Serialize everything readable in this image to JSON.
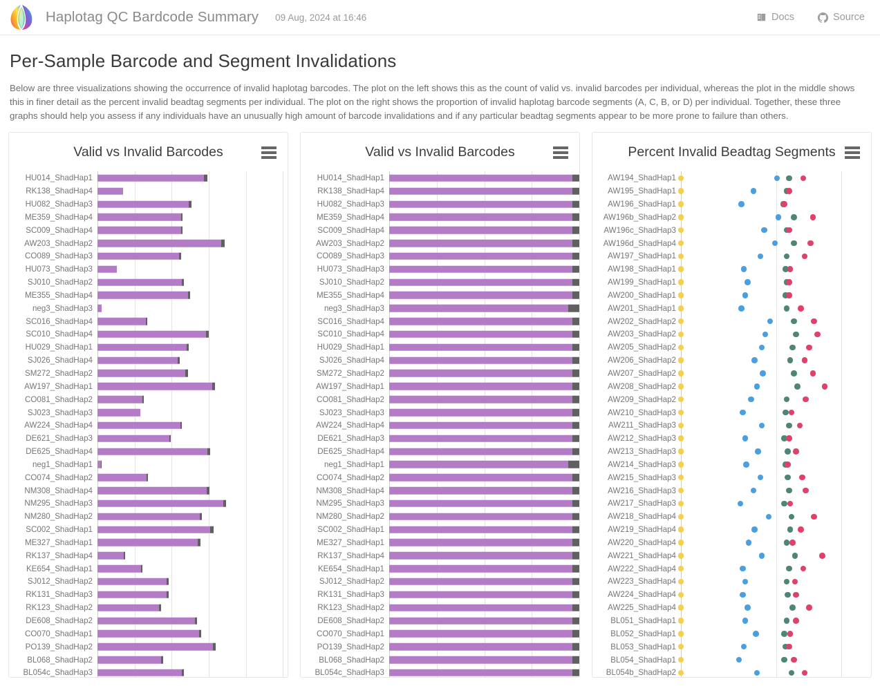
{
  "header": {
    "title": "Haplotag QC Bardcode Summary",
    "date": "09 Aug, 2024 at 16:46",
    "logo_icon": "harpy-feather-logo-icon",
    "links": [
      {
        "label": "Docs",
        "icon": "book-icon"
      },
      {
        "label": "Source",
        "icon": "github-icon"
      }
    ]
  },
  "section": {
    "title": "Per-Sample Barcode and Segment Invalidations",
    "description": "Below are three visualizations showing the occurrence of invalid haplotag barcodes. The plot on the left shows this as the count of valid vs. invalid barcodes per individual, whereas the plot in the middle shows this in finer detail as the percent invalid beadtag segments per individual. The plot on the right shows the proportion of invalid haplotag barcode segments (A, C, B, or D) per individual. Together, these three graphs should help you assess if any individuals have an unusually high amount of barcode invalidations and if any particular beadtag segments appear to be more prone to failure than others."
  },
  "panels": [
    {
      "title": "Valid vs Invalid Barcodes",
      "menu_icon": "hamburger-menu-icon"
    },
    {
      "title": "Valid vs Invalid Barcodes",
      "menu_icon": "hamburger-menu-icon"
    },
    {
      "title": "Percent Invalid Beadtag Segments",
      "menu_icon": "hamburger-menu-icon"
    }
  ],
  "colors": {
    "valid_bar": "#b47cc7",
    "invalid_bar": "#606060",
    "segment_a": "#f5d04e",
    "segment_c": "#4a9fe0",
    "segment_b": "#4e8574",
    "segment_d": "#e0416b",
    "gridline": "#e3e3e3",
    "axis": "#cdcdcd"
  },
  "chart_data": [
    {
      "type": "bar",
      "title": "Valid vs Invalid Barcodes",
      "orientation": "horizontal",
      "stacked": true,
      "xlabel": "",
      "ylabel": "",
      "grid": true,
      "xlim": [
        0,
        100
      ],
      "legend": [
        "valid",
        "invalid"
      ],
      "categories": [
        "HU014_ShadHap1",
        "RK138_ShadHap4",
        "HU082_ShadHap3",
        "ME359_ShadHap4",
        "SC009_ShadHap4",
        "AW203_ShadHap2",
        "CO089_ShadHap3",
        "HU073_ShadHap3",
        "SJ010_ShadHap2",
        "ME355_ShadHap4",
        "neg3_ShadHap3",
        "SC016_ShadHap4",
        "SC010_ShadHap4",
        "HU029_ShadHap1",
        "SJ026_ShadHap4",
        "SM272_ShadHap2",
        "AW197_ShadHap1",
        "CO081_ShadHap2",
        "SJ023_ShadHap3",
        "AW224_ShadHap4",
        "DE621_ShadHap3",
        "DE625_ShadHap4",
        "neg1_ShadHap1",
        "CO074_ShadHap2",
        "NM308_ShadHap4",
        "NM295_ShadHap3",
        "NM280_ShadHap2",
        "SC002_ShadHap1",
        "ME327_ShadHap1",
        "RK137_ShadHap4",
        "KE654_ShadHap1",
        "SJ012_ShadHap2",
        "RK131_ShadHap3",
        "RK123_ShadHap2",
        "DE608_ShadHap2",
        "CO070_ShadHap1",
        "PO139_ShadHap2",
        "BL068_ShadHap2",
        "BL054c_ShadHap3"
      ],
      "series": [
        {
          "name": "valid",
          "color": "#b47cc7",
          "values": [
            68.5,
            16.5,
            58.5,
            53.5,
            53.5,
            79.5,
            52.5,
            12.5,
            54.0,
            58.0,
            2.5,
            31.0,
            69.5,
            57.0,
            51.5,
            56.5,
            73.5,
            29.0,
            27.5,
            53.0,
            46.0,
            70.5,
            2.0,
            31.5,
            70.0,
            80.5,
            65.5,
            72.5,
            64.5,
            17.0,
            28.0,
            44.5,
            44.5,
            39.5,
            62.5,
            65.0,
            74.0,
            41.0,
            54.0
          ]
        },
        {
          "name": "invalid",
          "color": "#606060",
          "values": [
            1.8,
            0.0,
            1.6,
            1.2,
            1.2,
            2.2,
            1.1,
            0.0,
            1.3,
            1.6,
            0.0,
            1.0,
            1.7,
            1.4,
            1.3,
            1.4,
            2.0,
            0.9,
            0.0,
            1.3,
            1.1,
            1.7,
            0.5,
            1.0,
            1.7,
            2.2,
            1.6,
            1.9,
            1.6,
            0.8,
            0.9,
            1.2,
            1.2,
            1.1,
            1.5,
            1.6,
            2.0,
            1.1,
            1.3
          ]
        }
      ]
    },
    {
      "type": "bar",
      "title": "Valid vs Invalid Barcodes",
      "orientation": "horizontal",
      "stacked": true,
      "normalized": true,
      "xlabel": "",
      "ylabel": "",
      "grid": true,
      "xlim": [
        0,
        100
      ],
      "legend": [
        "valid",
        "invalid"
      ],
      "categories": [
        "HU014_ShadHap1",
        "RK138_ShadHap4",
        "HU082_ShadHap3",
        "ME359_ShadHap4",
        "SC009_ShadHap4",
        "AW203_ShadHap2",
        "CO089_ShadHap3",
        "HU073_ShadHap3",
        "SJ010_ShadHap2",
        "ME355_ShadHap4",
        "neg3_ShadHap3",
        "SC016_ShadHap4",
        "SC010_ShadHap4",
        "HU029_ShadHap1",
        "SJ026_ShadHap4",
        "SM272_ShadHap2",
        "AW197_ShadHap1",
        "CO081_ShadHap2",
        "SJ023_ShadHap3",
        "AW224_ShadHap4",
        "DE621_ShadHap3",
        "DE625_ShadHap4",
        "neg1_ShadHap1",
        "CO074_ShadHap2",
        "NM308_ShadHap4",
        "NM295_ShadHap3",
        "NM280_ShadHap2",
        "SC002_ShadHap1",
        "ME327_ShadHap1",
        "RK137_ShadHap4",
        "KE654_ShadHap1",
        "SJ012_ShadHap2",
        "RK131_ShadHap3",
        "RK123_ShadHap2",
        "DE608_ShadHap2",
        "CO070_ShadHap1",
        "PO139_ShadHap2",
        "BL068_ShadHap2",
        "BL054c_ShadHap3"
      ],
      "series": [
        {
          "name": "valid",
          "color": "#b47cc7",
          "values": [
            96.4,
            96.2,
            96.4,
            96.3,
            96.4,
            96.3,
            96.3,
            96.2,
            96.3,
            96.4,
            94.2,
            96.2,
            96.4,
            96.3,
            96.3,
            96.3,
            96.4,
            96.2,
            96.2,
            96.3,
            96.3,
            96.4,
            94.0,
            96.2,
            96.4,
            96.5,
            96.3,
            96.4,
            96.3,
            96.2,
            96.2,
            96.2,
            96.2,
            96.2,
            96.3,
            96.3,
            96.4,
            96.2,
            96.3
          ]
        },
        {
          "name": "invalid",
          "color": "#606060",
          "values": [
            3.6,
            3.8,
            3.6,
            3.7,
            3.6,
            3.7,
            3.7,
            3.8,
            3.7,
            3.6,
            5.8,
            3.8,
            3.6,
            3.7,
            3.7,
            3.7,
            3.6,
            3.8,
            3.8,
            3.7,
            3.7,
            3.6,
            6.0,
            3.8,
            3.6,
            3.5,
            3.7,
            3.6,
            3.7,
            3.8,
            3.8,
            3.8,
            3.8,
            3.8,
            3.7,
            3.7,
            3.6,
            3.8,
            3.7
          ]
        }
      ]
    },
    {
      "type": "scatter",
      "title": "Percent Invalid Beadtag Segments",
      "orientation": "horizontal",
      "xlabel": "",
      "ylabel": "",
      "grid": true,
      "xlim": [
        0,
        8
      ],
      "legend": [
        "A",
        "C",
        "B",
        "D"
      ],
      "series_colors": {
        "A": "#f5d04e",
        "C": "#4a9fe0",
        "B": "#4e8574",
        "D": "#e0416b"
      },
      "categories": [
        "AW194_ShadHap1",
        "AW195_ShadHap1",
        "AW196_ShadHap1",
        "AW196b_ShadHap2",
        "AW196c_ShadHap3",
        "AW196d_ShadHap4",
        "AW197_ShadHap1",
        "AW198_ShadHap1",
        "AW199_ShadHap1",
        "AW200_ShadHap1",
        "AW201_ShadHap1",
        "AW202_ShadHap2",
        "AW203_ShadHap2",
        "AW205_ShadHap2",
        "AW206_ShadHap2",
        "AW207_ShadHap2",
        "AW208_ShadHap2",
        "AW209_ShadHap2",
        "AW210_ShadHap3",
        "AW211_ShadHap3",
        "AW212_ShadHap3",
        "AW213_ShadHap3",
        "AW214_ShadHap3",
        "AW215_ShadHap3",
        "AW216_ShadHap3",
        "AW217_ShadHap3",
        "AW218_ShadHap4",
        "AW219_ShadHap4",
        "AW220_ShadHap4",
        "AW221_ShadHap4",
        "AW222_ShadHap4",
        "AW223_ShadHap4",
        "AW224_ShadHap4",
        "AW225_ShadHap4",
        "BL051_ShadHap1",
        "BL052_ShadHap1",
        "BL053_ShadHap1",
        "BL054_ShadHap1",
        "BL054b_ShadHap2"
      ],
      "series": [
        {
          "name": "A",
          "color": "#f5d04e",
          "values": [
            0,
            0,
            0,
            0,
            0,
            0,
            0,
            0,
            0,
            0,
            0,
            0,
            0,
            0,
            0,
            0,
            0,
            0,
            0,
            0,
            0,
            0,
            0,
            0,
            0,
            0,
            0,
            0,
            0,
            0,
            0,
            0,
            0,
            0,
            0,
            0,
            0,
            0,
            0
          ]
        },
        {
          "name": "C",
          "color": "#4a9fe0",
          "values": [
            4.05,
            3.05,
            2.55,
            4.1,
            3.5,
            3.95,
            3.35,
            2.65,
            2.8,
            2.7,
            2.55,
            3.75,
            3.55,
            3.4,
            3.1,
            3.45,
            3.2,
            2.95,
            2.6,
            3.4,
            2.7,
            3.25,
            2.75,
            3.35,
            3.05,
            2.5,
            3.7,
            3.1,
            2.85,
            3.4,
            2.6,
            2.7,
            2.6,
            2.8,
            2.7,
            3.15,
            2.65,
            2.45,
            3.2
          ]
        },
        {
          "name": "B",
          "color": "#4e8574",
          "values": [
            4.55,
            4.45,
            4.3,
            4.75,
            4.45,
            4.75,
            4.45,
            4.4,
            4.45,
            4.4,
            4.45,
            4.75,
            4.85,
            4.7,
            4.6,
            4.75,
            4.9,
            4.45,
            4.4,
            4.55,
            4.35,
            4.5,
            4.4,
            4.5,
            4.55,
            4.35,
            4.65,
            4.6,
            4.45,
            4.8,
            4.55,
            4.45,
            4.5,
            4.7,
            4.45,
            4.35,
            4.4,
            4.35,
            4.65
          ]
        },
        {
          "name": "D",
          "color": "#e0416b",
          "values": [
            5.15,
            4.55,
            4.35,
            5.55,
            4.55,
            5.45,
            5.2,
            4.6,
            4.55,
            4.55,
            5.05,
            5.6,
            5.75,
            5.4,
            5.2,
            5.55,
            6.05,
            5.25,
            4.65,
            5.0,
            4.55,
            4.85,
            4.5,
            5.1,
            5.25,
            4.6,
            5.6,
            5.05,
            4.7,
            5.95,
            5.15,
            4.8,
            4.85,
            5.4,
            4.85,
            4.6,
            4.55,
            4.75,
            5.2
          ]
        }
      ]
    }
  ]
}
